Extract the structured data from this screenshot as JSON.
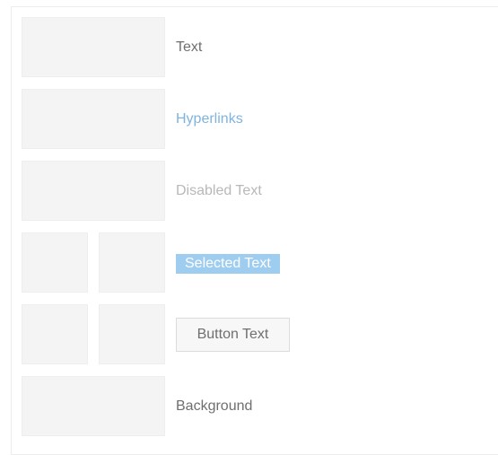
{
  "rows": [
    {
      "label": "Text"
    },
    {
      "label": "Hyperlinks"
    },
    {
      "label": "Disabled Text"
    },
    {
      "label": "Selected Text"
    },
    {
      "label": "Button Text"
    },
    {
      "label": "Background"
    }
  ],
  "colors": {
    "swatch_fill": "#f4f4f4",
    "text": "#6f6f6f",
    "hyperlink": "#7fb3e0",
    "disabled": "#b8b8b8",
    "selected_background": "#9fcdf0",
    "selected_text": "#ffffff",
    "button_background": "#f7f7f7",
    "button_border": "#dcdcdc",
    "background": "#ffffff"
  }
}
